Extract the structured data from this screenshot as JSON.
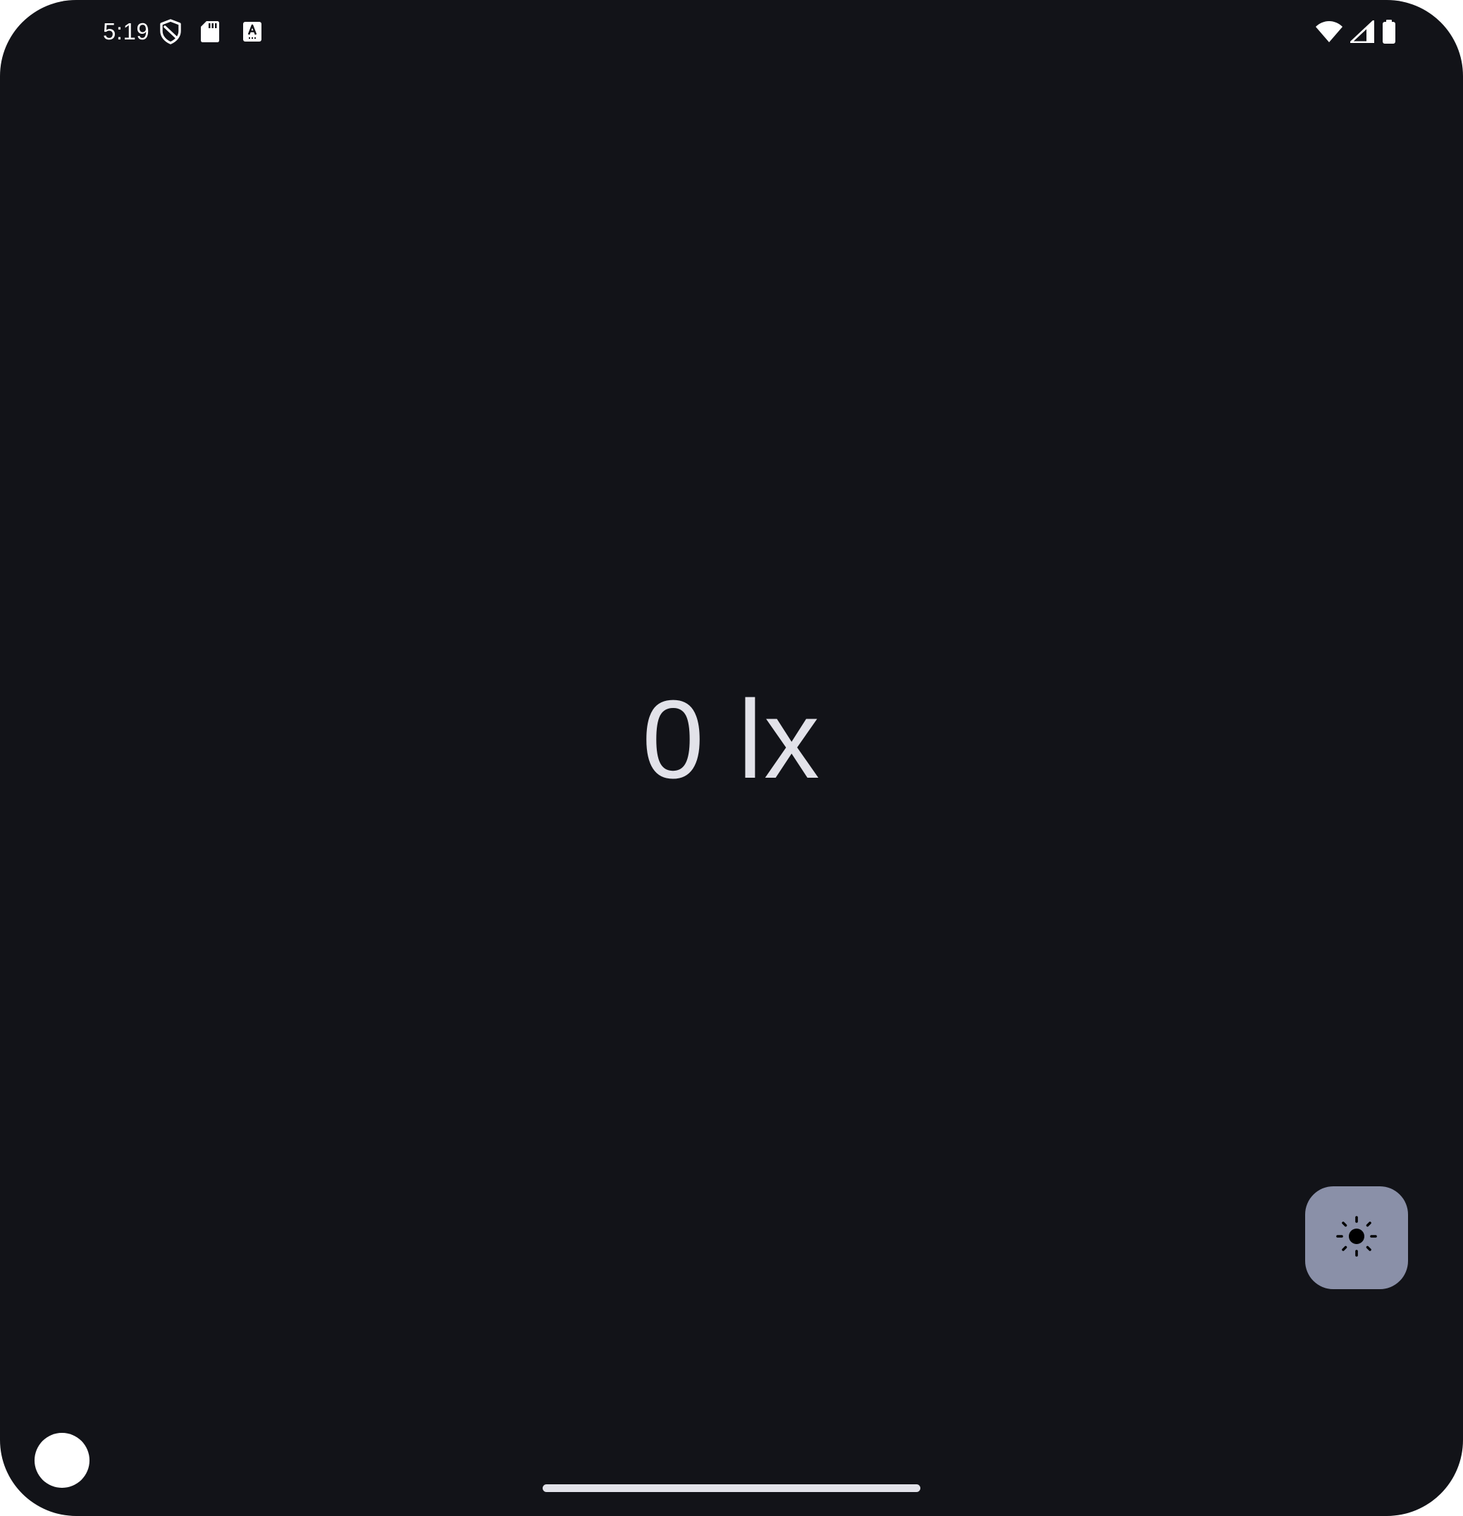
{
  "status_bar": {
    "time": "5:19",
    "left_icons": [
      "shield-icon",
      "sd-card-icon",
      "keyboard-a-icon"
    ],
    "right_icons": [
      "wifi-icon",
      "cellular-signal-icon",
      "battery-icon"
    ]
  },
  "main": {
    "lux_value": "0 lx"
  },
  "fab": {
    "icon": "brightness-icon"
  },
  "colors": {
    "background": "#121318",
    "text": "#e2e2e9",
    "fab_background": "#8a90a8"
  }
}
